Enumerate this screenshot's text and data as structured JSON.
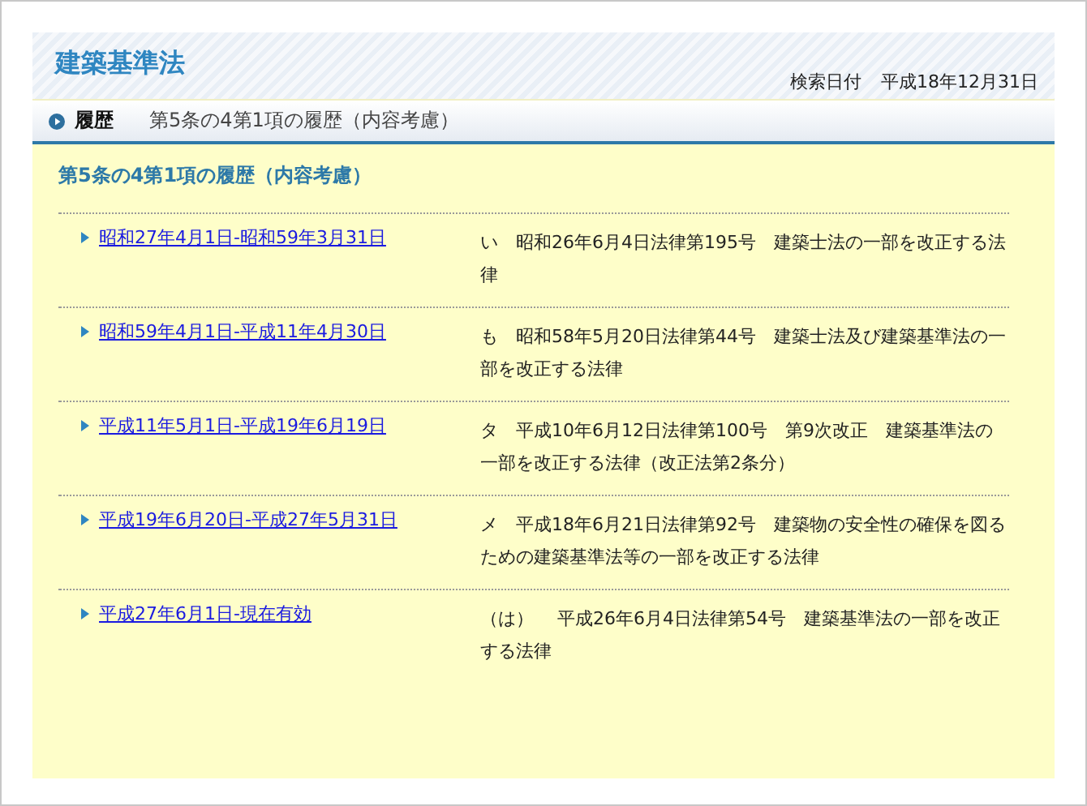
{
  "header": {
    "title": "建築基準法",
    "search_date_label": "検索日付",
    "search_date": "平成18年12月31日"
  },
  "breadcrumb": {
    "label": "履歴",
    "text": "第5条の4第1項の履歴（内容考慮）"
  },
  "section_title": "第5条の4第1項の履歴（内容考慮）",
  "history": [
    {
      "period": "昭和27年4月1日-昭和59年3月31日",
      "amendment": "い　昭和26年6月4日法律第195号　建築士法の一部を改正する法律"
    },
    {
      "period": "昭和59年4月1日-平成11年4月30日",
      "amendment": "も　昭和58年5月20日法律第44号　建築士法及び建築基準法の一部を改正する法律"
    },
    {
      "period": "平成11年5月1日-平成19年6月19日",
      "amendment": "タ　平成10年6月12日法律第100号　第9次改正　建築基準法の一部を改正する法律（改正法第2条分）"
    },
    {
      "period": "平成19年6月20日-平成27年5月31日",
      "amendment": "メ　平成18年6月21日法律第92号　建築物の安全性の確保を図るための建築基準法等の一部を改正する法律"
    },
    {
      "period": "平成27年6月1日-現在有効",
      "amendment": "（は）　 平成26年6月4日法律第54号　建築基準法の一部を改正する法律"
    }
  ]
}
